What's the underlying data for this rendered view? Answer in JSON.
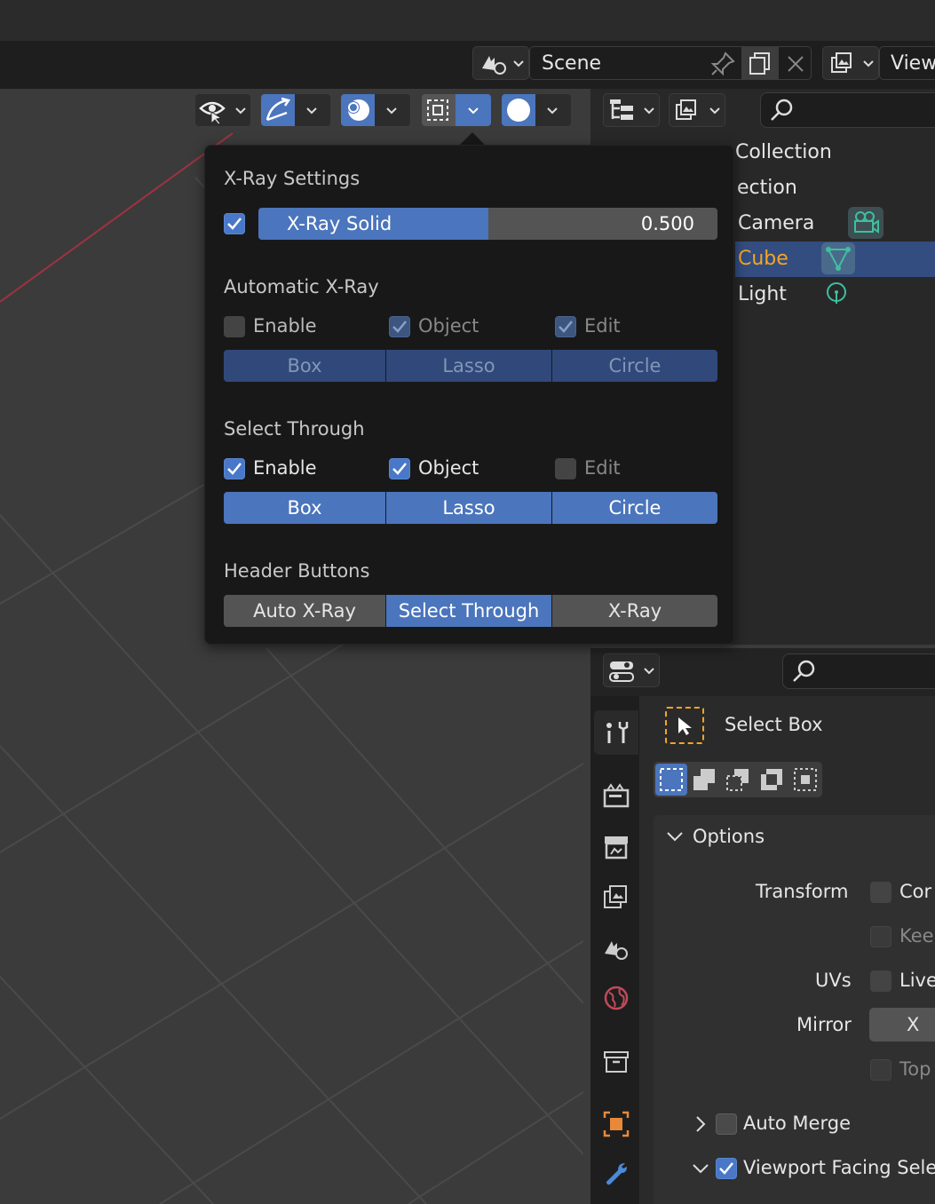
{
  "scene_bar": {
    "scene_name": "Scene",
    "view_layer": "View"
  },
  "outliner": {
    "items": [
      {
        "label": "Collection",
        "state": "normal"
      },
      {
        "label": "ection",
        "state": "normal"
      },
      {
        "label": "Camera",
        "state": "normal"
      },
      {
        "label": "Cube",
        "state": "selected"
      },
      {
        "label": "Light",
        "state": "normal"
      }
    ]
  },
  "xray_popup": {
    "section_xray": "X-Ray Settings",
    "xray_solid": {
      "label": "X-Ray Solid",
      "value": "0.500",
      "fraction": 0.5,
      "enabled": true
    },
    "section_auto": "Automatic X-Ray",
    "auto": {
      "enable": {
        "label": "Enable",
        "checked": false
      },
      "object": {
        "label": "Object",
        "checked": true
      },
      "edit": {
        "label": "Edit",
        "checked": true
      },
      "modes": [
        "Box",
        "Lasso",
        "Circle"
      ]
    },
    "section_select": "Select Through",
    "select": {
      "enable": {
        "label": "Enable",
        "checked": true
      },
      "object": {
        "label": "Object",
        "checked": true
      },
      "edit": {
        "label": "Edit",
        "checked": false
      },
      "modes": [
        "Box",
        "Lasso",
        "Circle"
      ]
    },
    "section_header": "Header Buttons",
    "header_buttons": [
      {
        "label": "Auto X-Ray",
        "active": false
      },
      {
        "label": "Select Through",
        "active": true
      },
      {
        "label": "X-Ray",
        "active": false
      }
    ]
  },
  "properties": {
    "tool_name": "Select Box",
    "options_title": "Options",
    "transform_label": "Transform",
    "transform_opt1": "Cor",
    "transform_opt2": "Kee",
    "uvs_label": "UVs",
    "uvs_opt": "Live",
    "mirror_label": "Mirror",
    "mirror_x": "X",
    "mirror_opt": "Top",
    "auto_merge": "Auto Merge",
    "viewport_facing": "Viewport Facing Sele"
  },
  "colors": {
    "accent_blue": "#4b75bc",
    "selected_orange": "#f5a623",
    "camera_icon": "#3fbf9f",
    "axis_red": "#a03240"
  }
}
